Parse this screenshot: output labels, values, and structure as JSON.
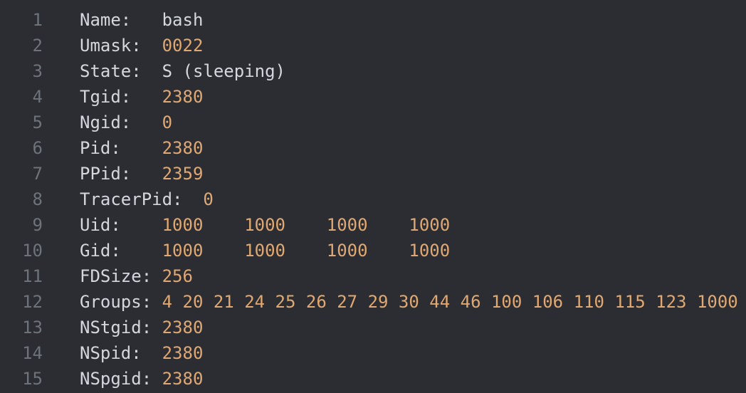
{
  "lines": [
    {
      "n": "1",
      "key": "Name:   ",
      "val": "bash",
      "kind": "str"
    },
    {
      "n": "2",
      "key": "Umask:  ",
      "val": "0022",
      "kind": "num"
    },
    {
      "n": "3",
      "key": "State:  ",
      "val": "S (sleeping)",
      "kind": "str"
    },
    {
      "n": "4",
      "key": "Tgid:   ",
      "val": "2380",
      "kind": "num"
    },
    {
      "n": "5",
      "key": "Ngid:   ",
      "val": "0",
      "kind": "num"
    },
    {
      "n": "6",
      "key": "Pid:    ",
      "val": "2380",
      "kind": "num"
    },
    {
      "n": "7",
      "key": "PPid:   ",
      "val": "2359",
      "kind": "num"
    },
    {
      "n": "8",
      "key": "TracerPid:  ",
      "val": "0",
      "kind": "num"
    },
    {
      "n": "9",
      "key": "Uid:    ",
      "val": "1000    1000    1000    1000",
      "kind": "num"
    },
    {
      "n": "10",
      "key": "Gid:    ",
      "val": "1000    1000    1000    1000",
      "kind": "num"
    },
    {
      "n": "11",
      "key": "FDSize: ",
      "val": "256",
      "kind": "num"
    },
    {
      "n": "12",
      "key": "Groups: ",
      "val": "4 20 21 24 25 26 27 29 30 44 46 100 106 110 115 123 1000",
      "kind": "num"
    },
    {
      "n": "13",
      "key": "NStgid: ",
      "val": "2380",
      "kind": "num"
    },
    {
      "n": "14",
      "key": "NSpid:  ",
      "val": "2380",
      "kind": "num"
    },
    {
      "n": "15",
      "key": "NSpgid: ",
      "val": "2380",
      "kind": "num"
    }
  ]
}
